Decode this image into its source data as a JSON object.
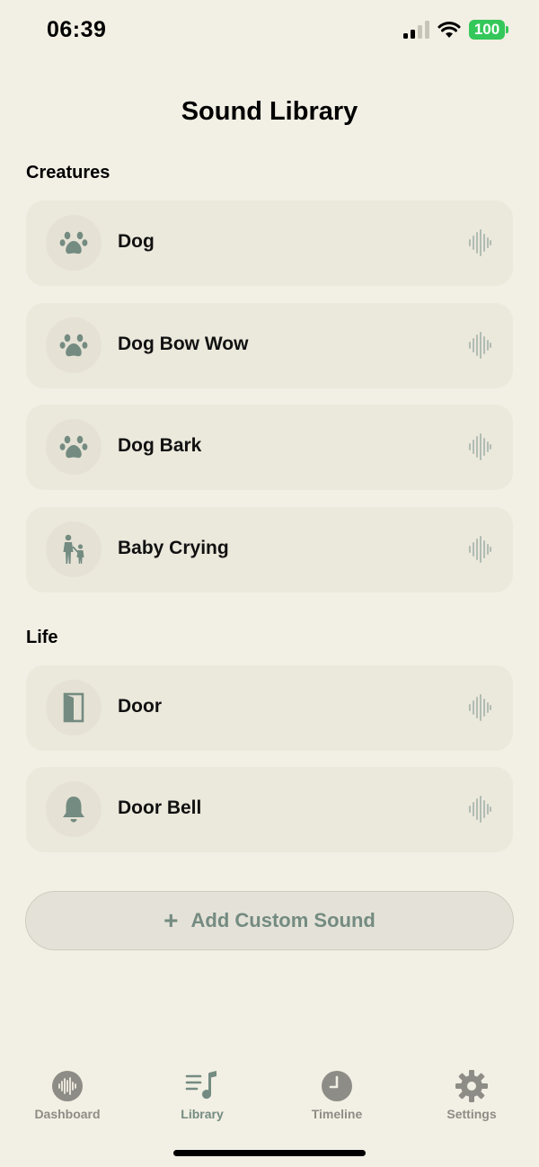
{
  "status_bar": {
    "time": "06:39",
    "battery": "100"
  },
  "page": {
    "title": "Sound Library"
  },
  "sections": [
    {
      "title": "Creatures",
      "items": [
        {
          "label": "Dog",
          "icon": "paw-icon"
        },
        {
          "label": "Dog Bow Wow",
          "icon": "paw-icon"
        },
        {
          "label": "Dog Bark",
          "icon": "paw-icon"
        },
        {
          "label": "Baby Crying",
          "icon": "parent-child-icon"
        }
      ]
    },
    {
      "title": "Life",
      "items": [
        {
          "label": "Door",
          "icon": "door-icon"
        },
        {
          "label": "Door Bell",
          "icon": "bell-icon"
        }
      ]
    }
  ],
  "add_button": {
    "plus": "+",
    "label": "Add Custom Sound"
  },
  "tab_bar": {
    "tabs": [
      {
        "label": "Dashboard",
        "icon": "waveform-circle-icon"
      },
      {
        "label": "Library",
        "icon": "music-list-icon"
      },
      {
        "label": "Timeline",
        "icon": "clock-icon"
      },
      {
        "label": "Settings",
        "icon": "gear-icon"
      }
    ],
    "active": "Library"
  },
  "colors": {
    "background": "#f2efe4",
    "card": "#ebe8dc",
    "accent": "#748b81",
    "inactive": "#8e8c86",
    "battery": "#34c759"
  }
}
